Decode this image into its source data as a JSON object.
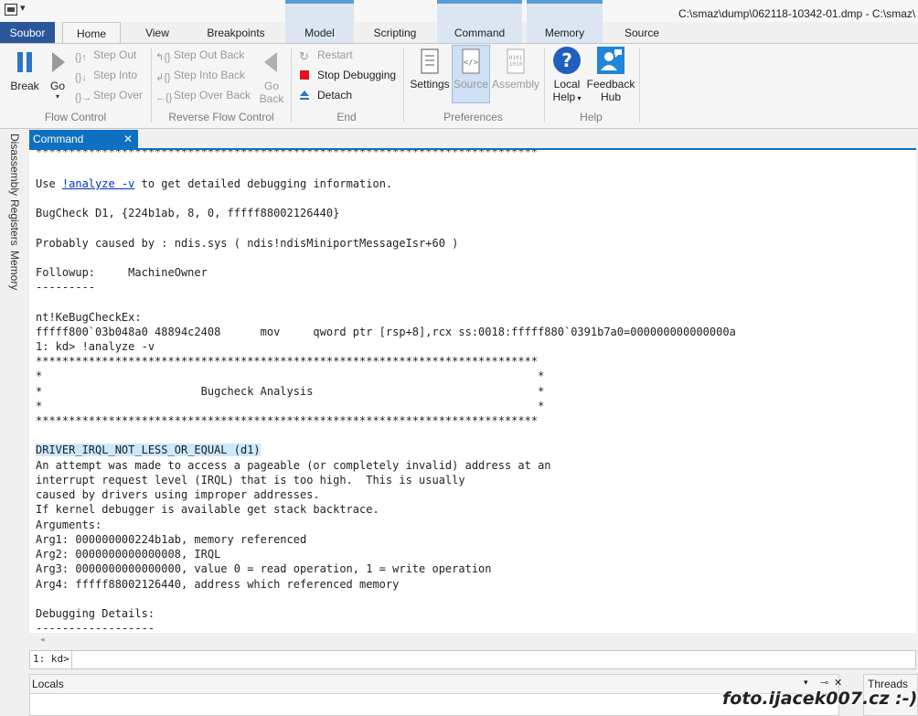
{
  "title": {
    "path": "C:\\smaz\\dump\\062118-10342-01.dmp - C:\\smaz\\"
  },
  "tabs": {
    "file": "Soubor",
    "home": "Home",
    "view": "View",
    "breakpoints": "Breakpoints",
    "model": "Model",
    "scripting": "Scripting",
    "command": "Command",
    "memory": "Memory",
    "source": "Source"
  },
  "ribbon": {
    "flow": {
      "label": "Flow Control",
      "break": "Break",
      "go": "Go",
      "step_out": "Step Out",
      "step_into": "Step Into",
      "step_over": "Step Over"
    },
    "reverse": {
      "label": "Reverse Flow Control",
      "step_out_back": "Step Out Back",
      "step_into_back": "Step Into Back",
      "step_over_back": "Step Over Back",
      "go_back_1": "Go",
      "go_back_2": "Back"
    },
    "end": {
      "label": "End",
      "restart": "Restart",
      "stop": "Stop Debugging",
      "detach": "Detach"
    },
    "prefs": {
      "label": "Preferences",
      "settings": "Settings",
      "source": "Source",
      "assembly": "Assembly"
    },
    "help": {
      "label": "Help",
      "local_1": "Local",
      "local_2": "Help",
      "feedback_1": "Feedback",
      "feedback_2": "Hub"
    }
  },
  "side_tabs": {
    "disassembly": "Disassembly",
    "registers": "Registers",
    "memory": "Memory"
  },
  "command": {
    "tab": "Command",
    "close": "✕",
    "stars": "****************************************************************************",
    "use_pre": "Use ",
    "use_link": "!analyze -v",
    "use_post": " to get detailed debugging information.",
    "bugcheck": "BugCheck D1, {224b1ab, 8, 0, fffff88002126440}",
    "caused": "Probably caused by : ndis.sys ( ndis!ndisMiniportMessageIsr+60 )",
    "followup": "Followup:     MachineOwner",
    "dashes": "---------",
    "kebug": "nt!KeBugCheckEx:",
    "asm": "fffff800`03b048a0 48894c2408      mov     qword ptr [rsp+8],rcx ss:0018:fffff880`0391b7a0=000000000000000a",
    "prompt_cmd": "1: kd> !analyze -v",
    "star_line": "*                                                                           *",
    "analysis": "*                        Bugcheck Analysis                                  *",
    "driver": "DRIVER_IRQL_NOT_LESS_OR_EQUAL (d1)",
    "desc": [
      "An attempt was made to access a pageable (or completely invalid) address at an",
      "interrupt request level (IRQL) that is too high.  This is usually",
      "caused by drivers using improper addresses.",
      "If kernel debugger is available get stack backtrace."
    ],
    "arguments": "Arguments:",
    "args": [
      "Arg1: 000000000224b1ab, memory referenced",
      "Arg2: 0000000000000008, IRQL",
      "Arg3: 0000000000000000, value 0 = read operation, 1 = write operation",
      "Arg4: fffff88002126440, address which referenced memory"
    ],
    "details": "Debugging Details:",
    "details_dashes": "------------------",
    "prompt": "1: kd>"
  },
  "bottom": {
    "locals": "Locals",
    "threads": "Threads"
  },
  "watermark": "foto.ijacek007.cz :-)",
  "colors": {
    "accent": "#0e70c0",
    "file_tab": "#2b579a",
    "context": "#dce6f2",
    "stop": "#e81123"
  }
}
